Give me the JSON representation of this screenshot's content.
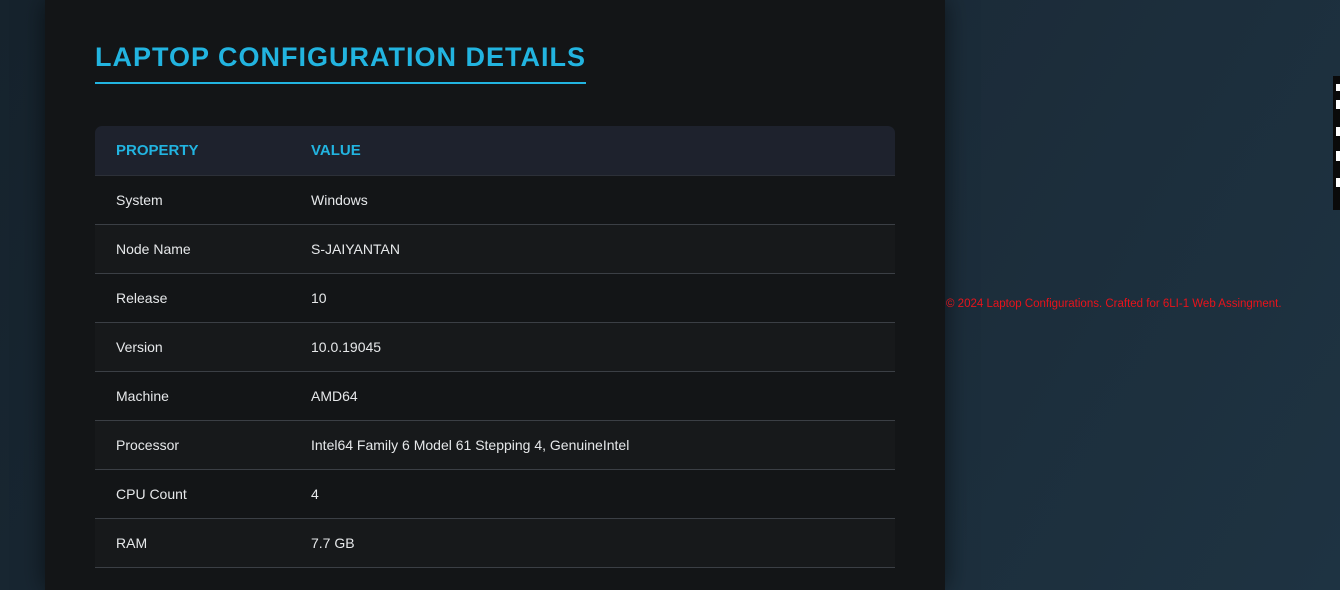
{
  "page": {
    "title": "LAPTOP CONFIGURATION DETAILS"
  },
  "table": {
    "headers": {
      "property": "PROPERTY",
      "value": "VALUE"
    },
    "rows": [
      {
        "property": "System",
        "value": "Windows"
      },
      {
        "property": "Node Name",
        "value": "S-JAIYANTAN"
      },
      {
        "property": "Release",
        "value": "10"
      },
      {
        "property": "Version",
        "value": "10.0.19045"
      },
      {
        "property": "Machine",
        "value": "AMD64"
      },
      {
        "property": "Processor",
        "value": "Intel64 Family 6 Model 61 Stepping 4, GenuineIntel"
      },
      {
        "property": "CPU Count",
        "value": "4"
      },
      {
        "property": "RAM",
        "value": "7.7 GB"
      }
    ]
  },
  "footer": {
    "text": "© 2024 Laptop Configurations. Crafted for 6LI-1 Web Assingment."
  },
  "colors": {
    "accent": "#22b4e0",
    "footer_text": "#e8131b",
    "card_background": "#131517",
    "header_background": "#1e222d"
  }
}
